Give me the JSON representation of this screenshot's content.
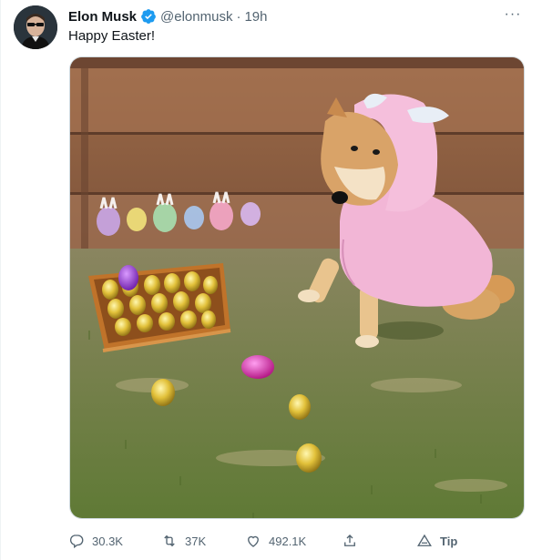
{
  "tweet": {
    "author_name": "Elon Musk",
    "author_handle": "@elonmusk",
    "separator": "·",
    "time": "19h",
    "text": "Happy Easter!",
    "more_label": "···"
  },
  "actions": {
    "replies": "30.3K",
    "retweets": "37K",
    "likes": "492.1K",
    "tip_label": "Tip"
  },
  "colors": {
    "verified": "#1d9bf0",
    "secondary_text": "#536471",
    "hoodie": "#f2b6d6",
    "grass": "#6f7d3e",
    "fence": "#a06b45"
  },
  "icons": {
    "verified": "verified-badge-icon",
    "reply": "reply-icon",
    "retweet": "retweet-icon",
    "like": "heart-icon",
    "share": "share-icon",
    "tip": "tip-icon",
    "more": "more-icon"
  }
}
